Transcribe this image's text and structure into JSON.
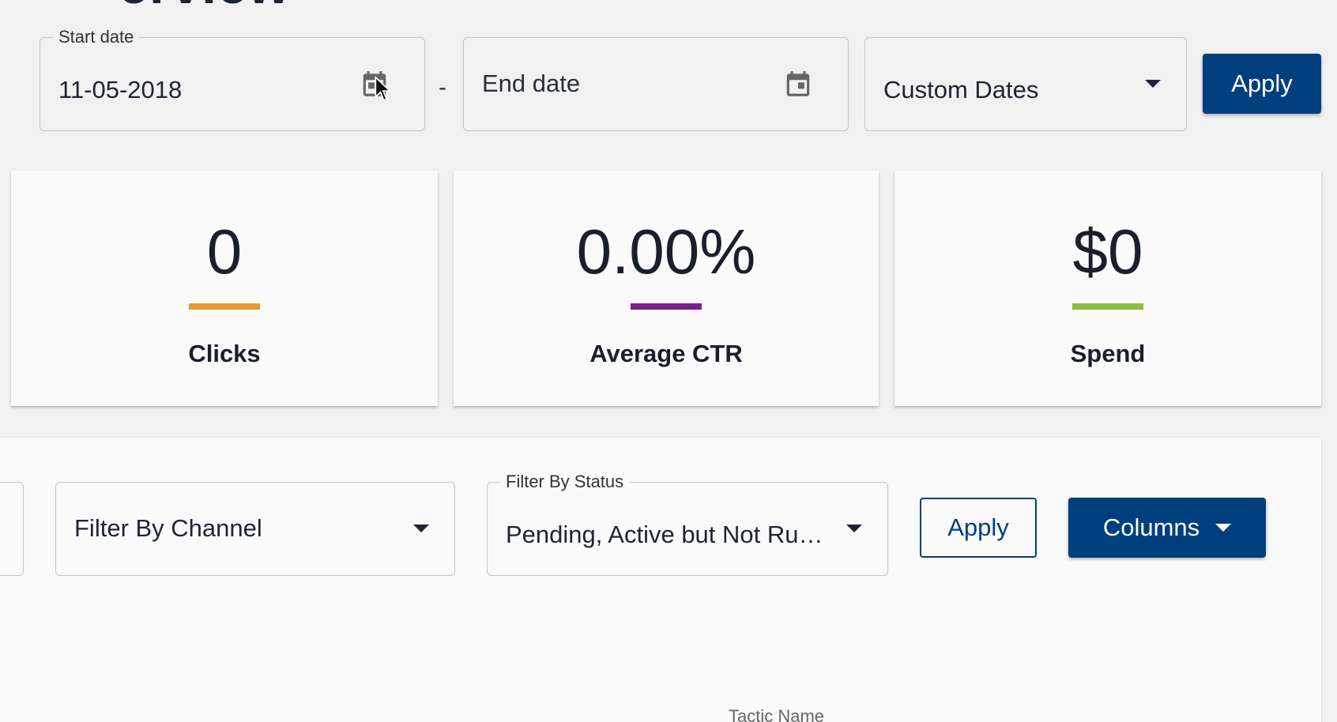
{
  "page": {
    "title_fragment": "erview"
  },
  "date_filter": {
    "start_label": "Start date",
    "start_value": "11-05-2018",
    "separator": "-",
    "end_placeholder": "End date",
    "range_value": "Custom Dates",
    "apply_label": "Apply"
  },
  "metrics": [
    {
      "value": "0",
      "label": "Clicks",
      "color": "#e89a2a"
    },
    {
      "value": "0.00%",
      "label": "Average CTR",
      "color": "#7b1f8c"
    },
    {
      "value": "$0",
      "label": "Spend",
      "color": "#8cbf3f"
    }
  ],
  "table_filters": {
    "channel_value": "Filter By Channel",
    "status_label": "Filter By Status",
    "status_value": "Pending, Active but Not Ru…",
    "apply_label": "Apply",
    "columns_label": "Columns"
  },
  "table": {
    "column_header": "Tactic Name"
  },
  "icons": {
    "start_calendar": "calendar-icon",
    "end_calendar": "calendar-icon",
    "range_caret": "caret-down-icon",
    "cursor": "mouse-pointer-icon"
  },
  "colors": {
    "primary": "#003f7d"
  }
}
